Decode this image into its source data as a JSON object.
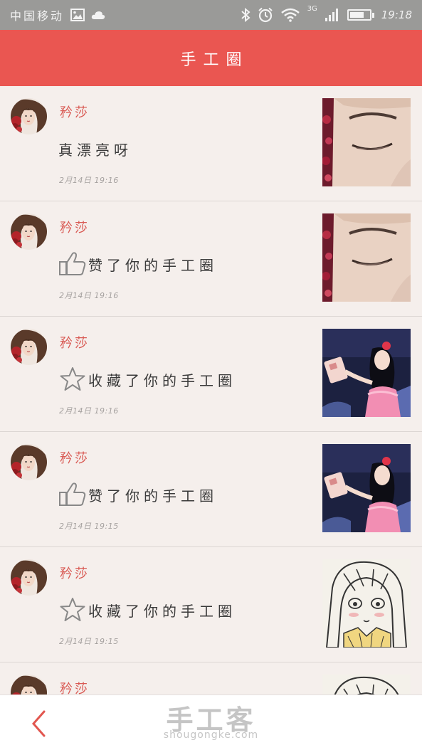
{
  "status_bar": {
    "carrier": "中国移动",
    "network_type": "3G",
    "time": "19:18"
  },
  "header": {
    "title": "手工圈"
  },
  "feed": [
    {
      "user": "矜莎",
      "message": "真漂亮呀",
      "action_icon": "",
      "time": "2月14日 19:16",
      "thumb": "face"
    },
    {
      "user": "矜莎",
      "message": "赞了你的手工圈",
      "action_icon": "thumbs-up-icon",
      "time": "2月14日 19:16",
      "thumb": "face"
    },
    {
      "user": "矜莎",
      "message": "收藏了你的手工圈",
      "action_icon": "star-icon",
      "time": "2月14日 19:16",
      "thumb": "doll"
    },
    {
      "user": "矜莎",
      "message": "赞了你的手工圈",
      "action_icon": "thumbs-up-icon",
      "time": "2月14日 19:15",
      "thumb": "doll"
    },
    {
      "user": "矜莎",
      "message": "收藏了你的手工圈",
      "action_icon": "star-icon",
      "time": "2月14日 19:15",
      "thumb": "sketch"
    },
    {
      "user": "矜莎",
      "message": "",
      "action_icon": "",
      "time": "",
      "thumb": "sketch"
    }
  ],
  "bottom_bar": {
    "back_icon": "chevron-left-icon",
    "watermark_cn": "手工客",
    "watermark_en": "shougongke.com"
  },
  "colors": {
    "header_bg": "#ea5651",
    "username": "#d95a54",
    "page_bg": "#f5efec",
    "status_bar_bg": "#9a9a98"
  }
}
